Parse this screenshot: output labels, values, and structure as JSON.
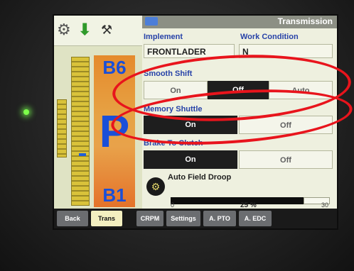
{
  "window": {
    "title": "Transmission"
  },
  "icons": {
    "top": [
      "tools-icon",
      "arrow-down-icon",
      "implement-icon"
    ],
    "field_droop": "field-droop-icon"
  },
  "ranges": {
    "top": "B6",
    "current": "P",
    "bottom": "B1"
  },
  "implement": {
    "label": "Implement",
    "value": "FRONTLADER"
  },
  "work_condition": {
    "label": "Work Condition",
    "value": "N"
  },
  "smooth_shift": {
    "label": "Smooth Shift",
    "options": [
      "On",
      "Off",
      "Auto"
    ],
    "selected": "Off"
  },
  "memory_shuttle": {
    "label": "Memory Shuttle",
    "options": [
      "On",
      "Off"
    ],
    "selected": "On"
  },
  "brake_to_clutch": {
    "label": "Brake To Clutch",
    "options": [
      "On",
      "Off"
    ],
    "selected": "On"
  },
  "auto_field_droop": {
    "label": "Auto Field Droop",
    "value_text": "25 %",
    "percent": 25,
    "min_label": "0",
    "max_label": "30"
  },
  "tabs": [
    {
      "label": "Back"
    },
    {
      "label": "Trans"
    },
    {
      "label": "CRPM"
    },
    {
      "label": "Settings"
    },
    {
      "label": "A. PTO"
    },
    {
      "label": "A. EDC"
    }
  ],
  "active_tab": "Trans",
  "colors": {
    "selected_button": "#1e1e1e",
    "label_blue": "#2742a8",
    "range_orange": "#e58a2c",
    "annotation_red": "#e8141c",
    "led_green": "#7dff4a"
  }
}
